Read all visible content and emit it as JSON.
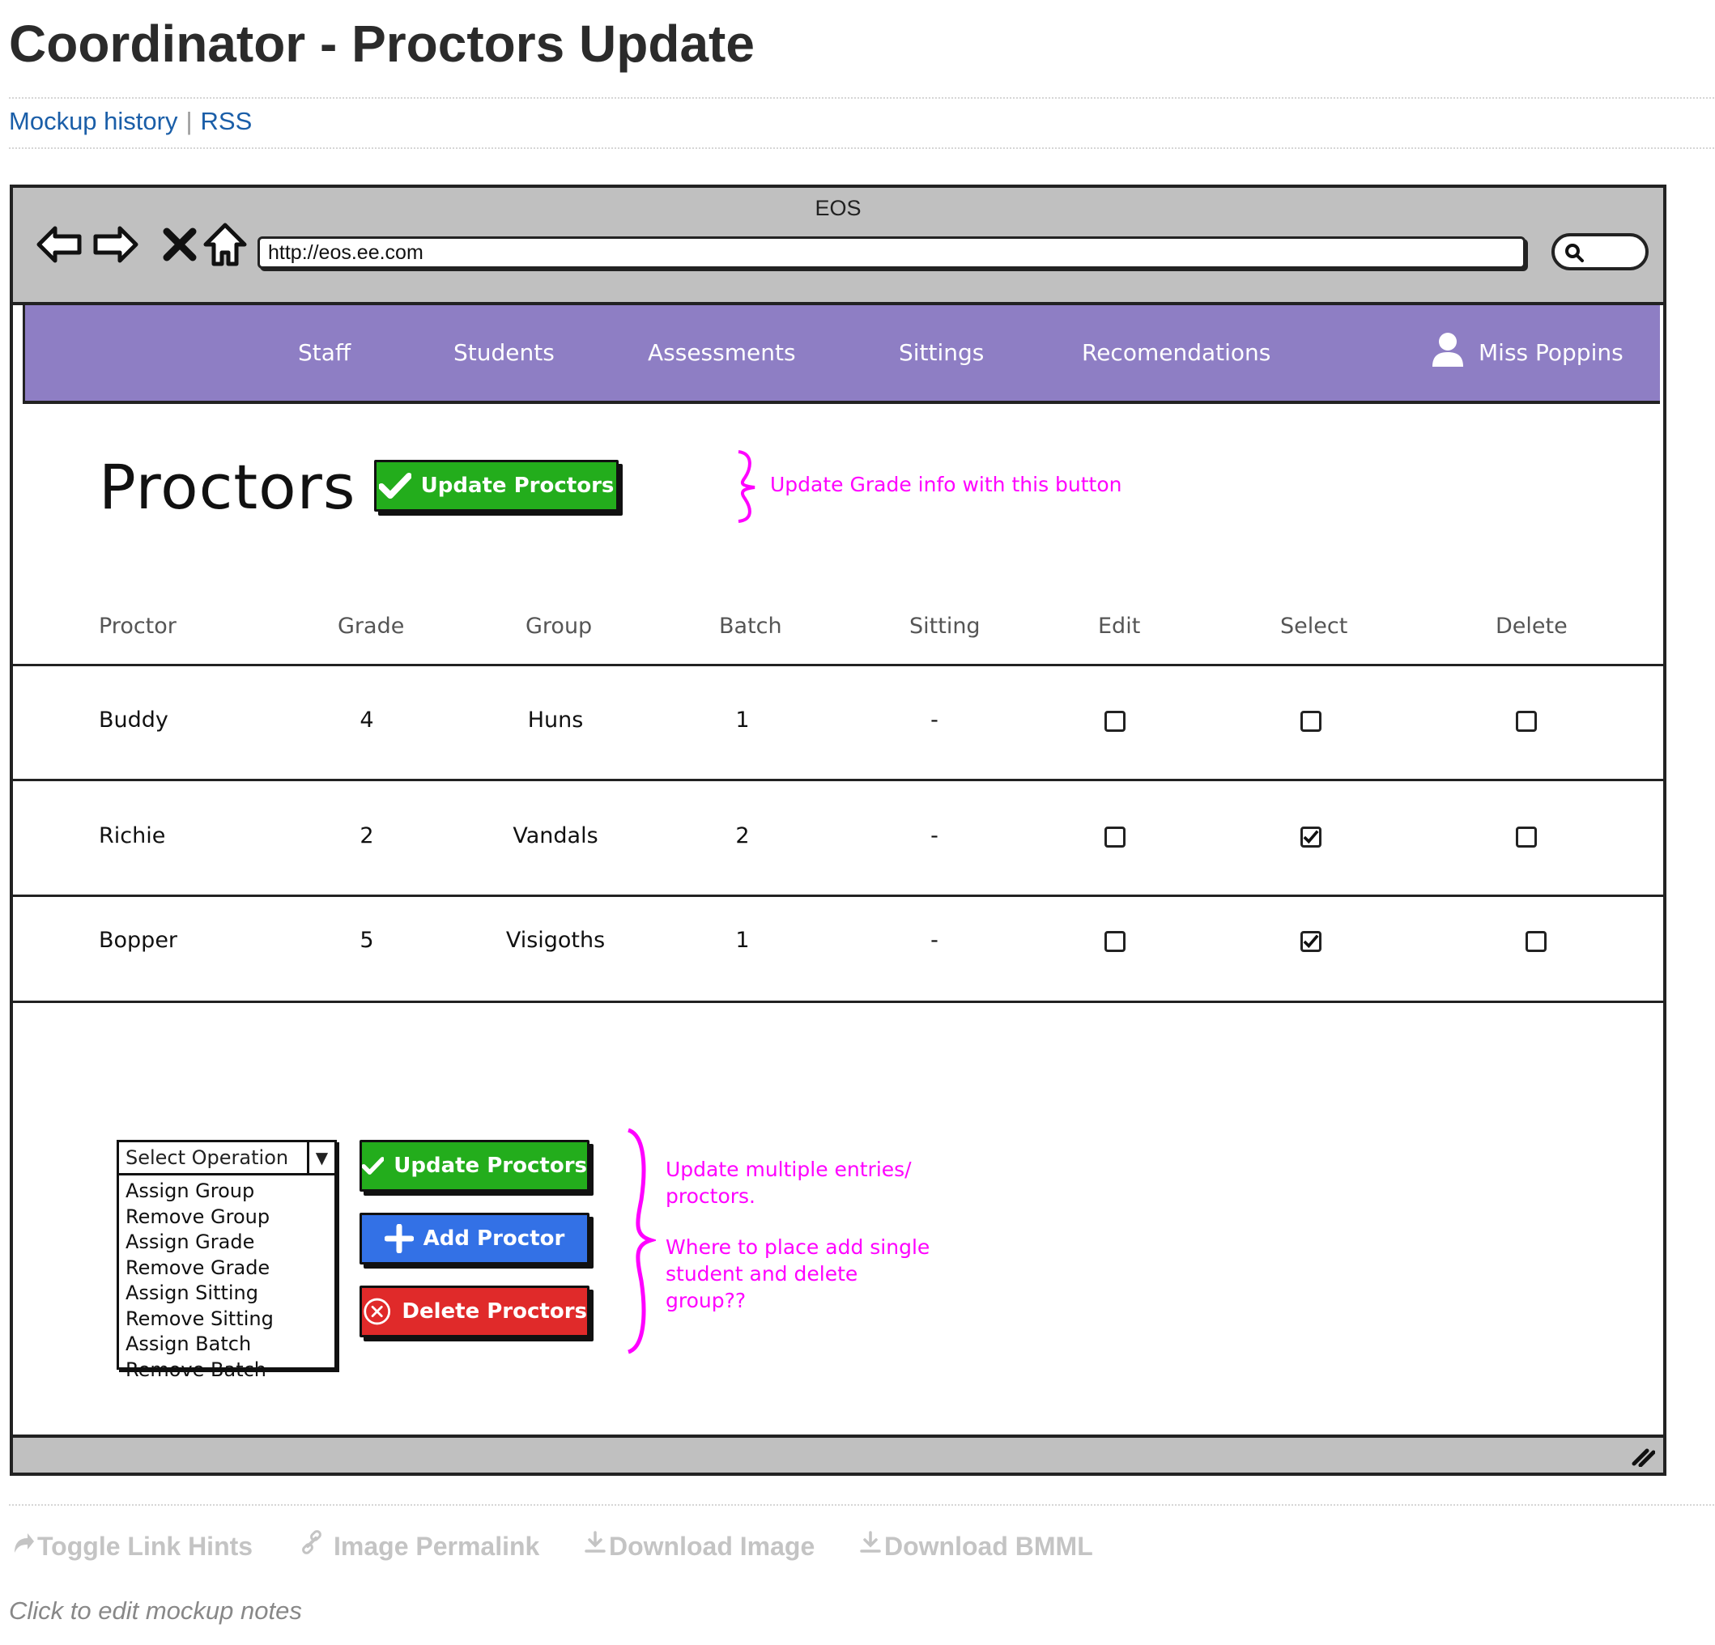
{
  "page": {
    "title": "Coordinator - Proctors Update",
    "links": {
      "history": "Mockup history",
      "rss": "RSS",
      "separator": "|"
    }
  },
  "browser": {
    "window_title": "EOS",
    "url": "http://eos.ee.com",
    "icons": [
      "back-arrow-icon",
      "forward-arrow-icon",
      "close-x-icon",
      "home-icon",
      "search-icon",
      "resize-grip-icon"
    ]
  },
  "nav": {
    "items": [
      "Staff",
      "Students",
      "Assessments",
      "Sittings",
      "Recomendations"
    ],
    "user": "Miss Poppins",
    "background": "#8e7ec4"
  },
  "header": {
    "heading": "Proctors",
    "update_button": "Update Proctors",
    "note": "Update Grade info with this button"
  },
  "table": {
    "columns": [
      "Proctor",
      "Grade",
      "Group",
      "Batch",
      "Sitting",
      "Edit",
      "Select",
      "Delete"
    ],
    "rows": [
      {
        "proctor": "Buddy",
        "grade": "4",
        "group": "Huns",
        "batch": "1",
        "sitting": "-",
        "edit": false,
        "select": false,
        "delete": false
      },
      {
        "proctor": "Richie",
        "grade": "2",
        "group": "Vandals",
        "batch": "2",
        "sitting": "-",
        "edit": false,
        "select": true,
        "delete": false
      },
      {
        "proctor": "Bopper",
        "grade": "5",
        "group": "Visigoths",
        "batch": "1",
        "sitting": "-",
        "edit": false,
        "select": true,
        "delete": false
      }
    ]
  },
  "operations": {
    "select_label": "Select Operation",
    "options": [
      "Assign Group",
      "Remove Group",
      "Assign Grade",
      "Remove Grade",
      "Assign Sitting",
      "Remove Sitting",
      "Assign Batch",
      "Remove Batch"
    ]
  },
  "actions": {
    "update": "Update Proctors",
    "add": "Add Proctor",
    "delete": "Delete Proctors",
    "note_1": "Update multiple entries/ proctors.",
    "note_2": "Where to place add single student and delete group??"
  },
  "colors": {
    "green": "#23ad1c",
    "blue": "#3371e6",
    "red": "#e02a2a",
    "annotation": "#ff00ff",
    "link": "#1a5ea8"
  },
  "footer": {
    "toggle": "Toggle Link Hints",
    "permalink": "Image Permalink",
    "download_image": "Download Image",
    "download_bmml": "Download BMML",
    "notes": "Click to edit mockup notes"
  }
}
